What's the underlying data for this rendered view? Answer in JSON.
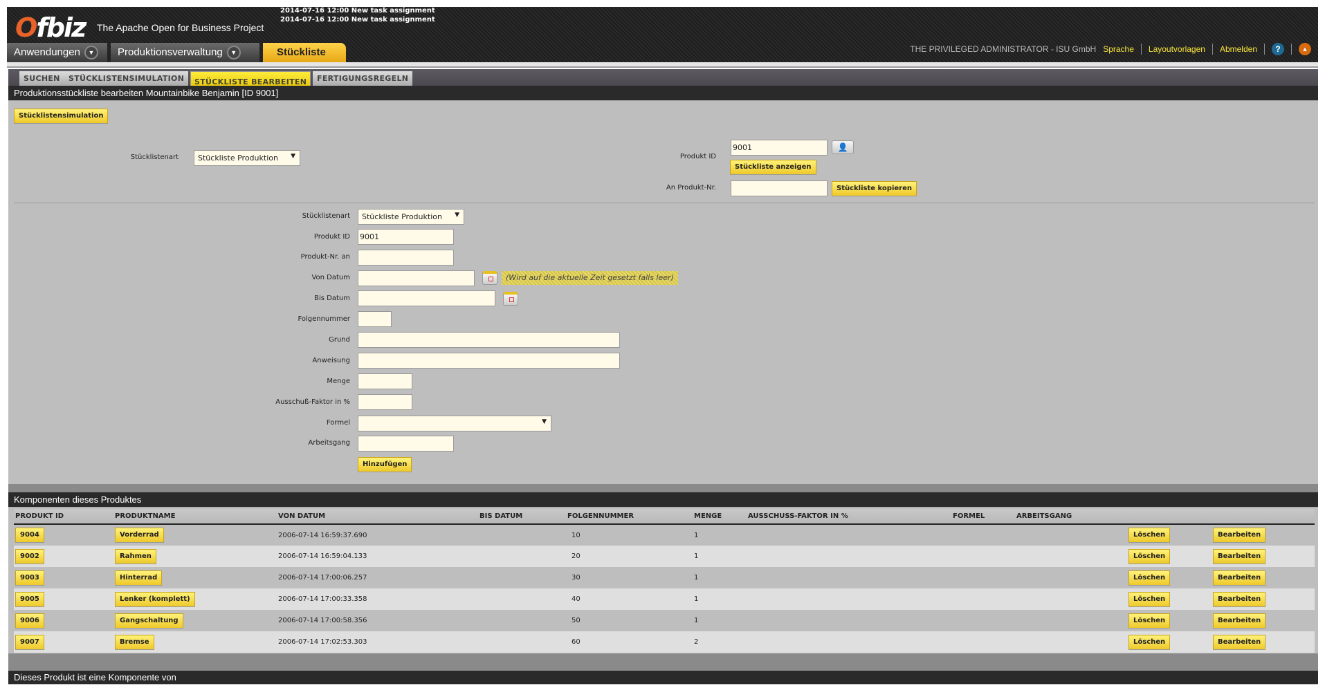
{
  "header": {
    "logo": "Ofbiz",
    "app_title": "The Apache Open for Business Project",
    "news": [
      "2014-07-16 12:00 New task assignment",
      "2014-07-16 12:00 New task assignment"
    ],
    "nav": [
      "Anwendungen",
      "Produktionsverwaltung",
      "Stückliste"
    ],
    "user": "THE PRIVILEGED ADMINISTRATOR - ISU GmbH",
    "links": [
      "Sprache",
      "Layoutvorlagen",
      "Abmelden"
    ],
    "help": "?",
    "up": "▲"
  },
  "tabs": [
    "SUCHEN",
    "STÜCKLISTENSIMULATION",
    "STÜCKLISTE BEARBEITEN",
    "FERTIGUNGSREGELN"
  ],
  "page_title": "Produktionsstückliste bearbeiten Mountainbike Benjamin [ID 9001]",
  "sim_button": "Stücklistensimulation",
  "lookup": {
    "type_label": "Stücklistenart",
    "type_value": "Stückliste Produktion",
    "product_label": "Produkt ID",
    "product_value": "9001",
    "show_button": "Stückliste anzeigen",
    "copy_label": "An Produkt-Nr.",
    "copy_value": "",
    "copy_button": "Stückliste kopieren"
  },
  "form": {
    "type_label": "Stücklistenart",
    "type_value": "Stückliste Produktion",
    "product_label": "Produkt ID",
    "product_value": "9001",
    "to_label": "Produkt-Nr. an",
    "from_date_label": "Von Datum",
    "from_hint": "(Wird auf die aktuelle Zeit gesetzt falls leer)",
    "thru_date_label": "Bis Datum",
    "seq_label": "Folgennummer",
    "reason_label": "Grund",
    "instruction_label": "Anweisung",
    "qty_label": "Menge",
    "scrap_label": "Ausschuß-Faktor in %",
    "formula_label": "Formel",
    "formula_value": "",
    "routing_label": "Arbeitsgang",
    "add_button": "Hinzufügen"
  },
  "components": {
    "title": "Komponenten dieses Produktes",
    "columns": [
      "PRODUKT ID",
      "PRODUKTNAME",
      "VON DATUM",
      "BIS DATUM",
      "FOLGENNUMMER",
      "MENGE",
      "AUSSCHUSS-FAKTOR IN %",
      "FORMEL",
      "ARBEITSGANG",
      "",
      ""
    ],
    "delete_label": "Löschen",
    "edit_label": "Bearbeiten",
    "rows": [
      {
        "id": "9004",
        "name": "Vorderrad",
        "from": "2006-07-14 16:59:37.690",
        "thru": "",
        "seq": "10",
        "qty": "1",
        "scrap": "",
        "formula": "",
        "routing": ""
      },
      {
        "id": "9002",
        "name": "Rahmen",
        "from": "2006-07-14 16:59:04.133",
        "thru": "",
        "seq": "20",
        "qty": "1",
        "scrap": "",
        "formula": "",
        "routing": ""
      },
      {
        "id": "9003",
        "name": "Hinterrad",
        "from": "2006-07-14 17:00:06.257",
        "thru": "",
        "seq": "30",
        "qty": "1",
        "scrap": "",
        "formula": "",
        "routing": ""
      },
      {
        "id": "9005",
        "name": "Lenker (komplett)",
        "from": "2006-07-14 17:00:33.358",
        "thru": "",
        "seq": "40",
        "qty": "1",
        "scrap": "",
        "formula": "",
        "routing": ""
      },
      {
        "id": "9006",
        "name": "Gangschaltung",
        "from": "2006-07-14 17:00:58.356",
        "thru": "",
        "seq": "50",
        "qty": "1",
        "scrap": "",
        "formula": "",
        "routing": ""
      },
      {
        "id": "9007",
        "name": "Bremse",
        "from": "2006-07-14 17:02:53.303",
        "thru": "",
        "seq": "60",
        "qty": "2",
        "scrap": "",
        "formula": "",
        "routing": ""
      }
    ]
  },
  "component_of": {
    "title": "Dieses Produkt ist eine Komponente von"
  }
}
